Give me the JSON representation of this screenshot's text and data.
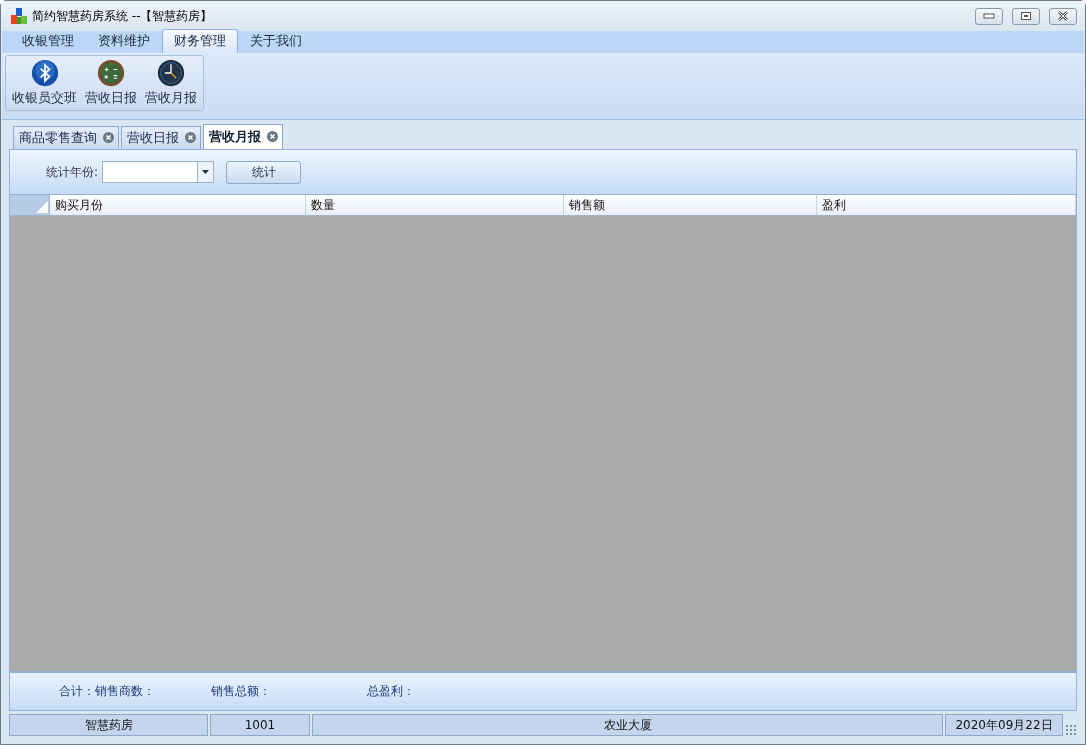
{
  "window": {
    "title": "简约智慧药房系统 --【智慧药房】"
  },
  "menu_tabs": [
    {
      "label": "收银管理",
      "selected": false
    },
    {
      "label": "资料维护",
      "selected": false
    },
    {
      "label": "财务管理",
      "selected": true
    },
    {
      "label": "关于我们",
      "selected": false
    }
  ],
  "ribbon": [
    {
      "label": "收银员交班",
      "kind": "bluetooth"
    },
    {
      "label": "营收日报",
      "kind": "calculator"
    },
    {
      "label": "营收月报",
      "kind": "clock"
    }
  ],
  "doc_tabs": [
    {
      "label": "商品零售查询",
      "selected": false
    },
    {
      "label": "营收日报",
      "selected": false
    },
    {
      "label": "营收月报",
      "selected": true
    }
  ],
  "filter": {
    "label": "统计年份:",
    "button": "统计"
  },
  "table": {
    "columns": [
      "购买月份",
      "数量",
      "销售额",
      "盈利"
    ]
  },
  "summary": [
    "合计：销售商数：",
    "销售总额：",
    "总盈利："
  ],
  "status_bar": [
    "智慧药房",
    "1001",
    "农业大厦",
    "2020年09月22日"
  ]
}
